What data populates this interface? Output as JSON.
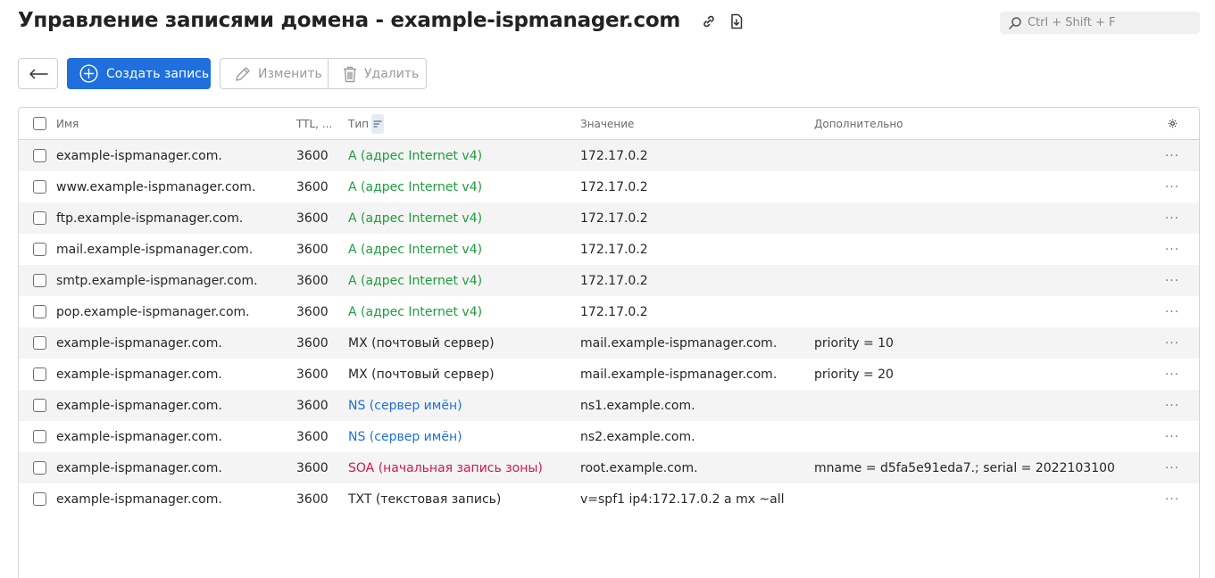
{
  "header": {
    "title": "Управление записями домена - example-ispmanager.com",
    "search_placeholder": "Ctrl + Shift + F"
  },
  "toolbar": {
    "create_label": "Создать запись",
    "edit_label": "Изменить",
    "delete_label": "Удалить"
  },
  "table": {
    "columns": {
      "name": "Имя",
      "ttl": "TTL, ...",
      "type": "Тип",
      "value": "Значение",
      "extra": "Дополнительно"
    },
    "rows": [
      {
        "name": "example-ispmanager.com.",
        "ttl": "3600",
        "type": "A (адрес Internet v4)",
        "type_color": "green",
        "value": "172.17.0.2",
        "extra": ""
      },
      {
        "name": "www.example-ispmanager.com.",
        "ttl": "3600",
        "type": "A (адрес Internet v4)",
        "type_color": "green",
        "value": "172.17.0.2",
        "extra": ""
      },
      {
        "name": "ftp.example-ispmanager.com.",
        "ttl": "3600",
        "type": "A (адрес Internet v4)",
        "type_color": "green",
        "value": "172.17.0.2",
        "extra": ""
      },
      {
        "name": "mail.example-ispmanager.com.",
        "ttl": "3600",
        "type": "A (адрес Internet v4)",
        "type_color": "green",
        "value": "172.17.0.2",
        "extra": ""
      },
      {
        "name": "smtp.example-ispmanager.com.",
        "ttl": "3600",
        "type": "A (адрес Internet v4)",
        "type_color": "green",
        "value": "172.17.0.2",
        "extra": ""
      },
      {
        "name": "pop.example-ispmanager.com.",
        "ttl": "3600",
        "type": "A (адрес Internet v4)",
        "type_color": "green",
        "value": "172.17.0.2",
        "extra": ""
      },
      {
        "name": "example-ispmanager.com.",
        "ttl": "3600",
        "type": "MX (почтовый сервер)",
        "type_color": "plain",
        "value": "mail.example-ispmanager.com.",
        "extra": "priority = 10"
      },
      {
        "name": "example-ispmanager.com.",
        "ttl": "3600",
        "type": "MX (почтовый сервер)",
        "type_color": "plain",
        "value": "mail.example-ispmanager.com.",
        "extra": "priority = 20"
      },
      {
        "name": "example-ispmanager.com.",
        "ttl": "3600",
        "type": "NS (сервер имён)",
        "type_color": "blue",
        "value": "ns1.example.com.",
        "extra": ""
      },
      {
        "name": "example-ispmanager.com.",
        "ttl": "3600",
        "type": "NS (сервер имён)",
        "type_color": "blue",
        "value": "ns2.example.com.",
        "extra": ""
      },
      {
        "name": "example-ispmanager.com.",
        "ttl": "3600",
        "type": "SOA (начальная запись зоны)",
        "type_color": "red",
        "value": "root.example.com.",
        "extra": "mname = d5fa5e91eda7.; serial = 2022103100"
      },
      {
        "name": "example-ispmanager.com.",
        "ttl": "3600",
        "type": "TXT (текстовая запись)",
        "type_color": "plain",
        "value": "v=spf1 ip4:172.17.0.2 a mx ~all",
        "extra": ""
      }
    ]
  },
  "colors": {
    "accent": "#1f6fde",
    "green": "#1e9e3c",
    "blue": "#1f6fde",
    "red": "#d11a4f"
  },
  "icons": [
    "link-icon",
    "download-icon",
    "search-icon",
    "back-arrow-icon",
    "plus-circle-icon",
    "pencil-icon",
    "trash-icon",
    "gear-icon",
    "sort-icon",
    "more-icon"
  ]
}
